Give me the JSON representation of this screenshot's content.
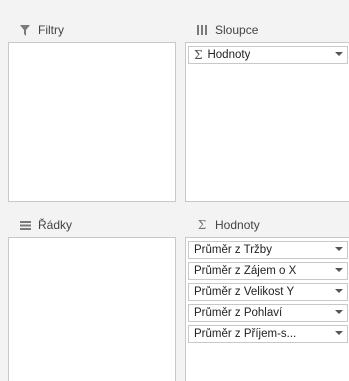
{
  "filters": {
    "title": "Filtry",
    "icon": "filter-icon"
  },
  "columns": {
    "title": "Sloupce",
    "icon": "columns-icon",
    "fields": [
      {
        "label": "Hodnoty",
        "sigma": "Σ"
      }
    ]
  },
  "rows": {
    "title": "Řádky",
    "icon": "rows-icon"
  },
  "values": {
    "title": "Hodnoty",
    "sigma": "Σ",
    "icon": "sigma-icon",
    "fields": [
      {
        "label": "Průměr z Tržby"
      },
      {
        "label": "Průměr z Zájem o X"
      },
      {
        "label": "Průměr z Velikost Y"
      },
      {
        "label": "Průměr z Pohlaví"
      },
      {
        "label": "Průměr z Příjem-s..."
      }
    ]
  }
}
